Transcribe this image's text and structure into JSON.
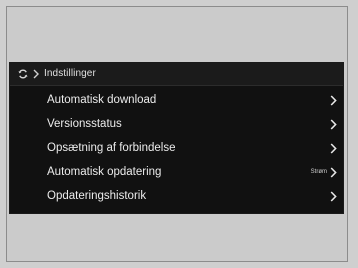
{
  "header": {
    "icon": "sync-icon",
    "separator_icon": "chevron-right-icon",
    "title": "Indstillinger"
  },
  "menu": {
    "chevron_icon": "chevron-right-icon",
    "items": [
      {
        "label": "Automatisk download"
      },
      {
        "label": "Versionsstatus"
      },
      {
        "label": "Opsætning af forbindelse"
      },
      {
        "label": "Automatisk opdatering",
        "value": "Strøm"
      },
      {
        "label": "Opdateringshistorik"
      }
    ]
  },
  "colors": {
    "screen_background": "#111111",
    "text": "#ececec",
    "frame_background": "#cbcbcb"
  }
}
